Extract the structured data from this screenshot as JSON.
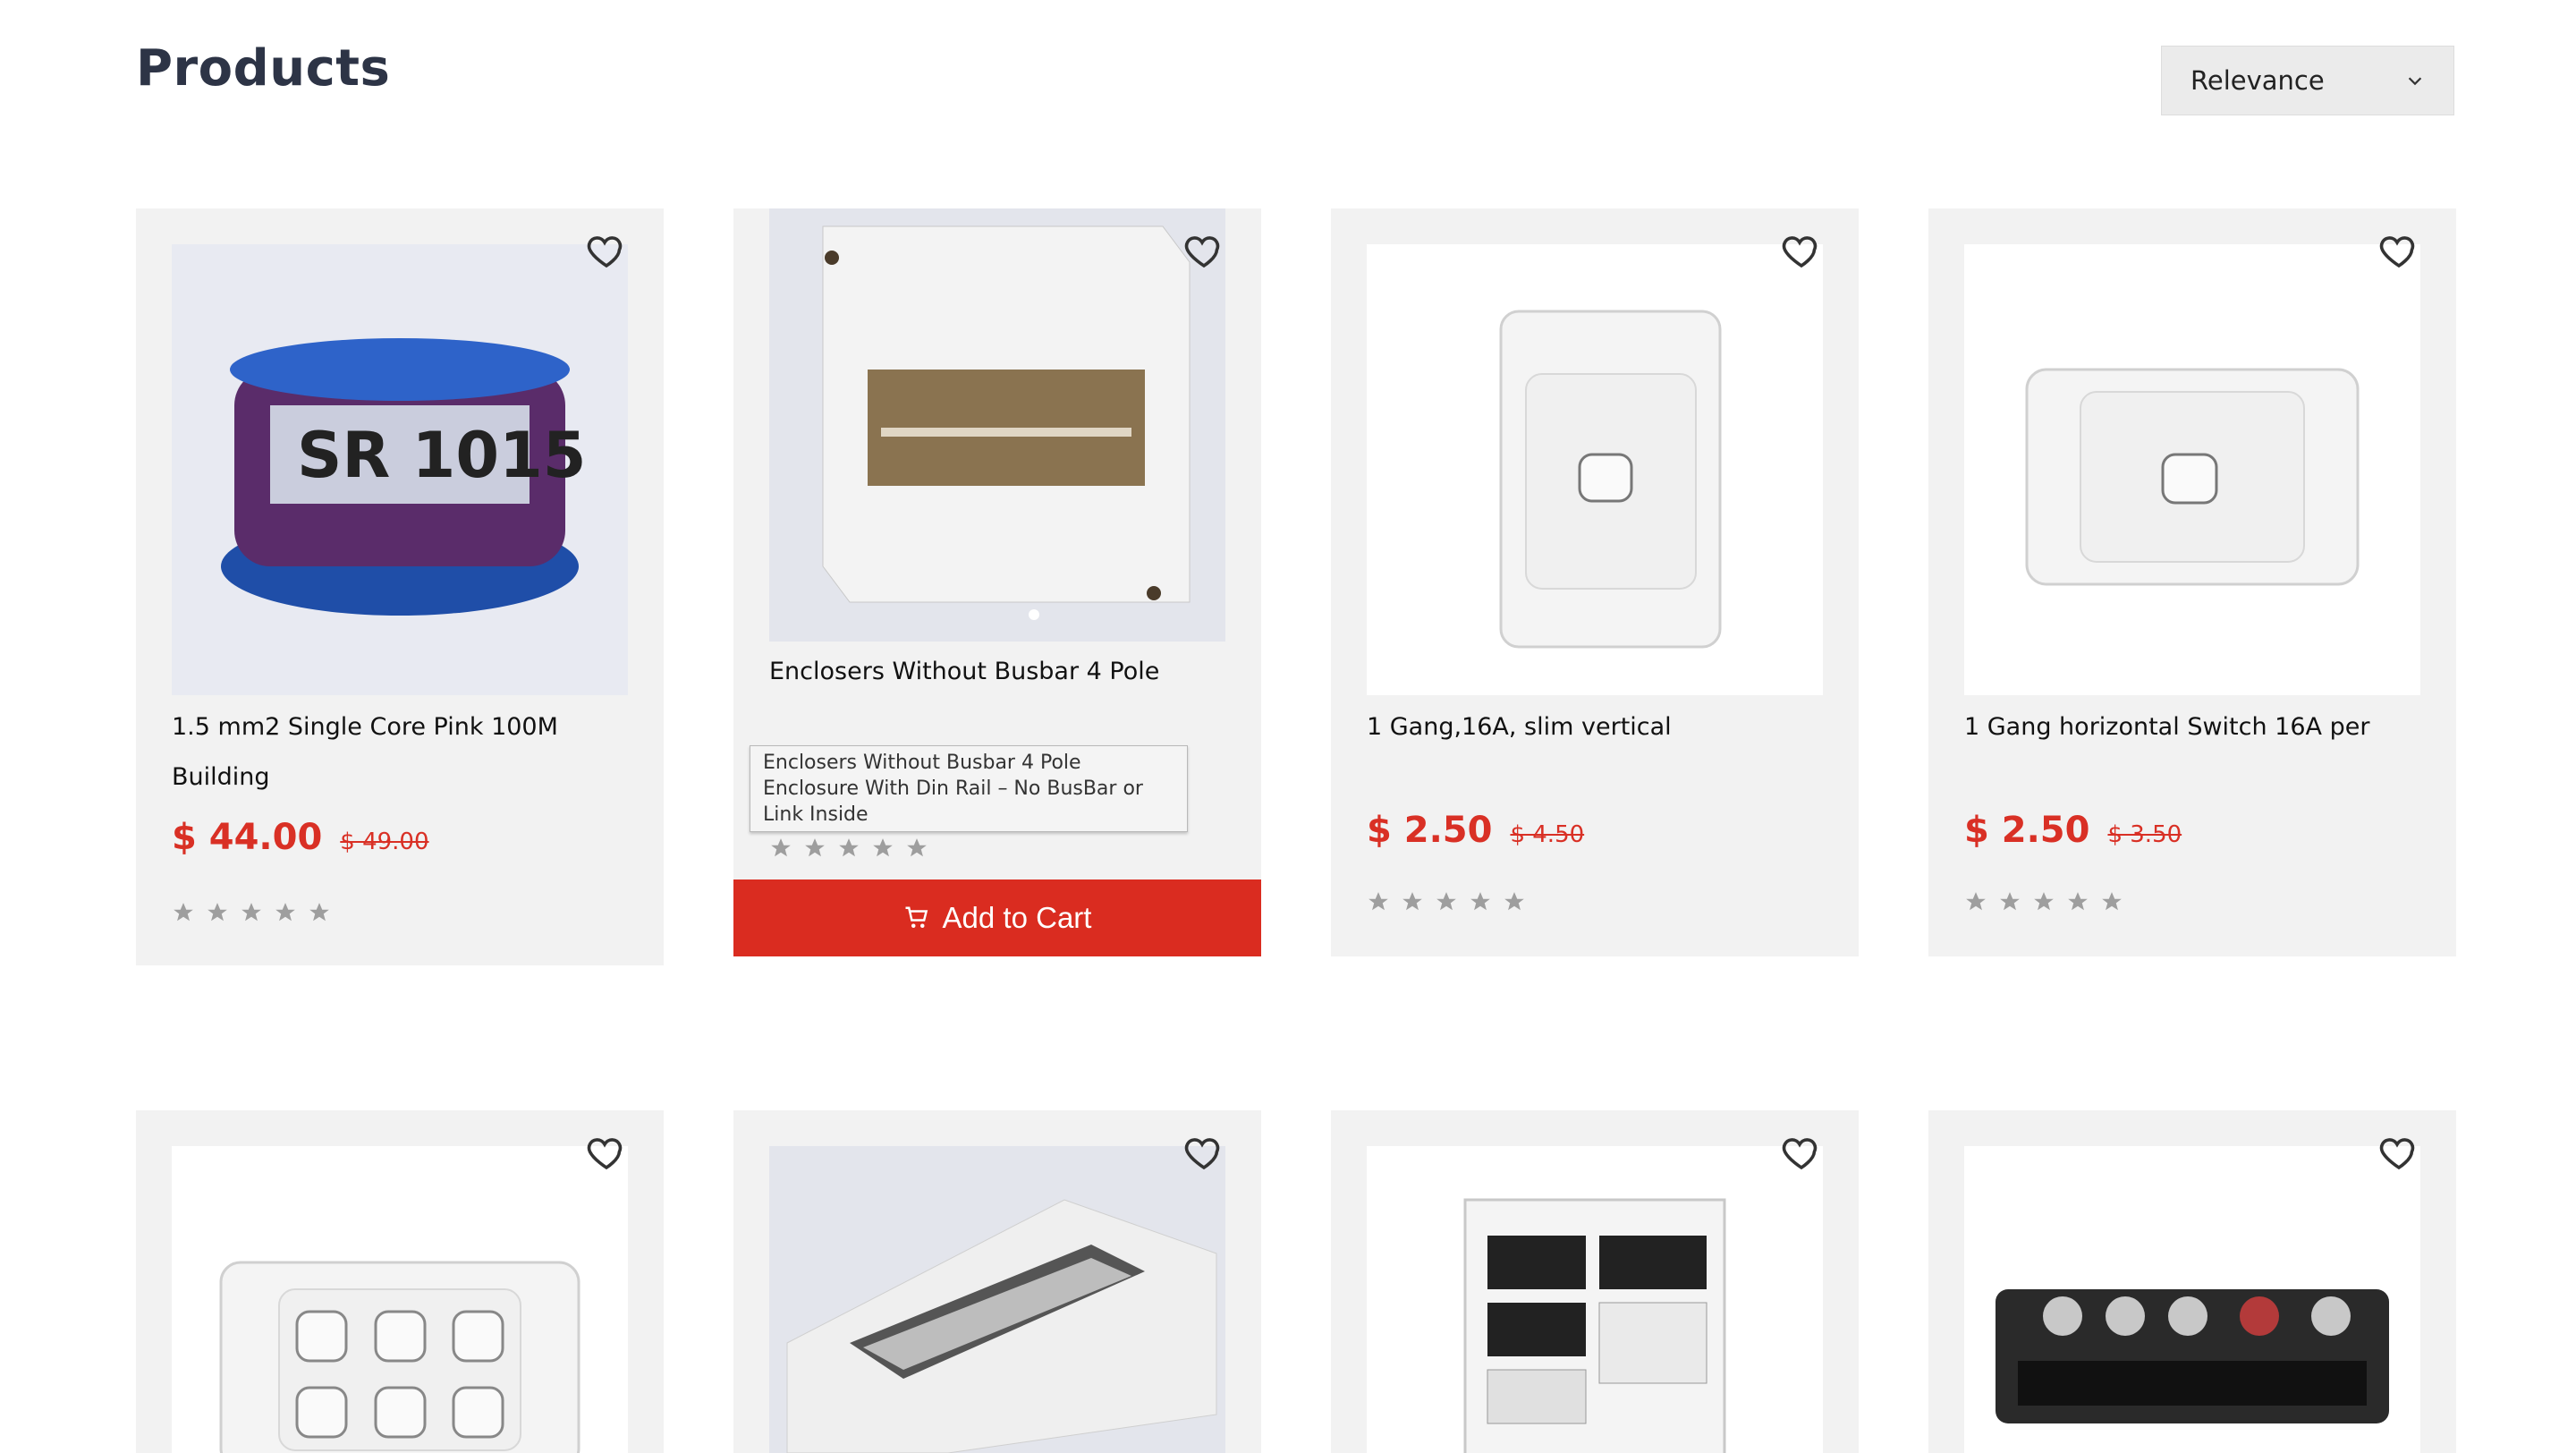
{
  "header": {
    "title": "Products"
  },
  "sort": {
    "selected": "Relevance"
  },
  "products": [
    {
      "name": "1.5 mm2 Single Core Pink 100M Building",
      "price": "$ 44.00",
      "old_price": "$ 49.00",
      "rating": 0
    },
    {
      "name": "Enclosers Without Busbar 4 Pole",
      "tooltip": "Enclosers Without Busbar 4 Pole Enclosure With Din Rail – No BusBar or Link Inside",
      "rating": 0,
      "add_to_cart": "Add to Cart"
    },
    {
      "name": "1 Gang,16A, slim vertical",
      "price": "$ 2.50",
      "old_price": "$ 4.50",
      "rating": 0
    },
    {
      "name": "1 Gang horizontal Switch 16A per",
      "price": "$ 2.50",
      "old_price": "$ 3.50",
      "rating": 0
    }
  ],
  "colors": {
    "accent": "#da2c20",
    "price": "#d93025",
    "card_bg": "#f2f2f2",
    "star": "#9e9e9e"
  }
}
